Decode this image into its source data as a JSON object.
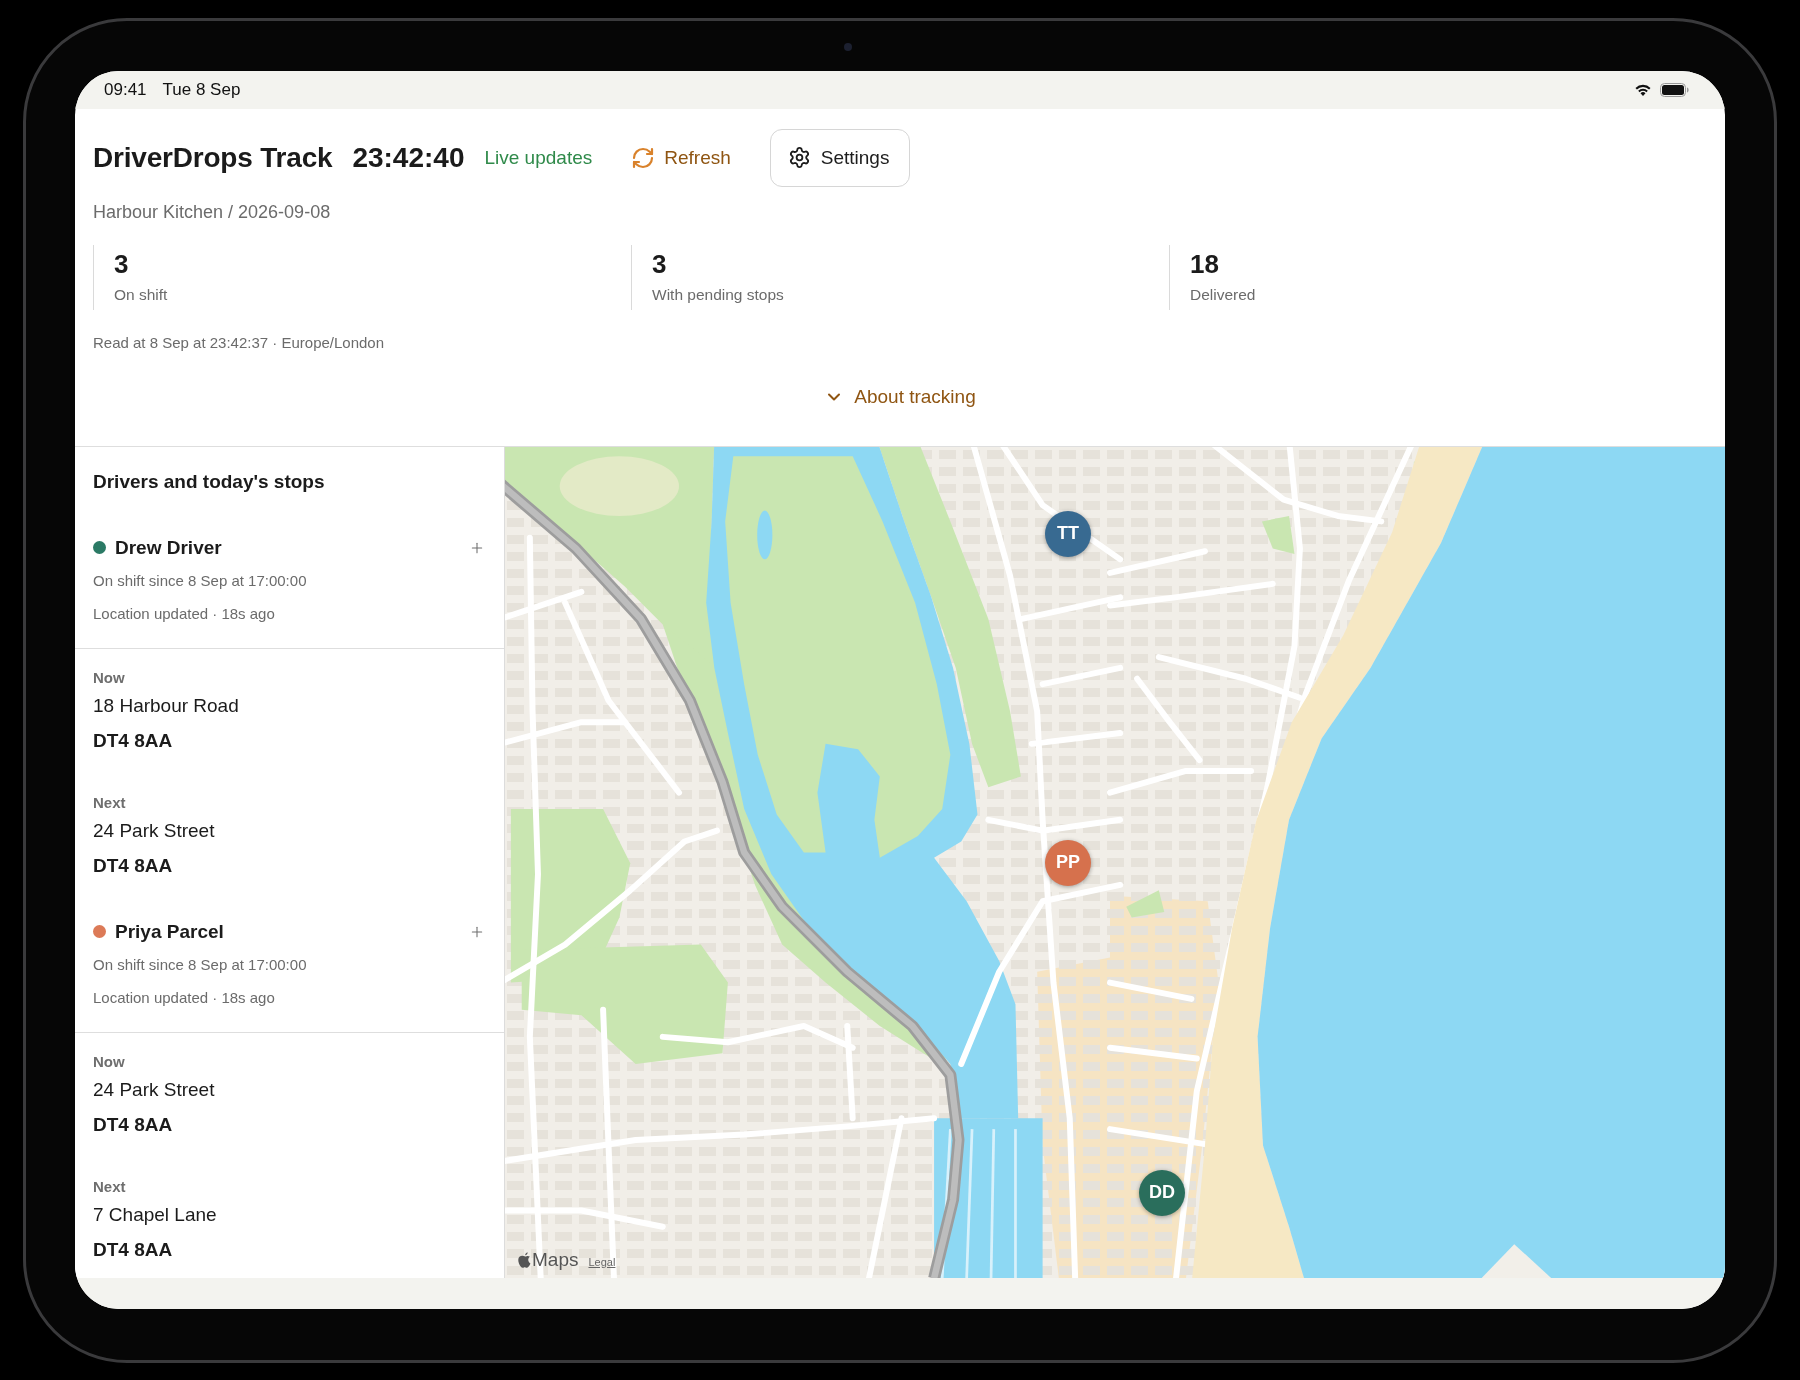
{
  "status_bar": {
    "time": "09:41",
    "date": "Tue 8 Sep"
  },
  "header": {
    "title": "DriverDrops Track",
    "clock": "23:42:40",
    "live_status": "Live updates",
    "refresh_label": "Refresh",
    "settings_label": "Settings",
    "subtitle": "Harbour Kitchen / 2026-09-08"
  },
  "stats": [
    {
      "value": "3",
      "label": "On shift"
    },
    {
      "value": "3",
      "label": "With pending stops"
    },
    {
      "value": "18",
      "label": "Delivered"
    }
  ],
  "read_at": "Read at 8 Sep at 23:42:37 · Europe/London",
  "about": {
    "label": "About tracking",
    "expanded": false
  },
  "sidebar": {
    "title": "Drivers and today's stops",
    "drivers": [
      {
        "name": "Drew Driver",
        "color": "#2b7a65",
        "shift": "On shift since 8 Sep at 17:00:00",
        "location": "Location updated · 18s ago",
        "stops": [
          {
            "label": "Now",
            "address": "18 Harbour Road",
            "postcode": "DT4 8AA"
          },
          {
            "label": "Next",
            "address": "24 Park Street",
            "postcode": "DT4 8AA"
          }
        ]
      },
      {
        "name": "Priya Parcel",
        "color": "#dc7a57",
        "shift": "On shift since 8 Sep at 17:00:00",
        "location": "Location updated · 18s ago",
        "stops": [
          {
            "label": "Now",
            "address": "24 Park Street",
            "postcode": "DT4 8AA"
          },
          {
            "label": "Next",
            "address": "7 Chapel Lane",
            "postcode": "DT4 8AA"
          }
        ]
      }
    ]
  },
  "map": {
    "markers": [
      {
        "initials": "TT",
        "color": "#386a91"
      },
      {
        "initials": "PP",
        "color": "#d6714d"
      },
      {
        "initials": "DD",
        "color": "#2a6e5c"
      }
    ],
    "brand": "Maps",
    "legal_link": "Legal"
  }
}
